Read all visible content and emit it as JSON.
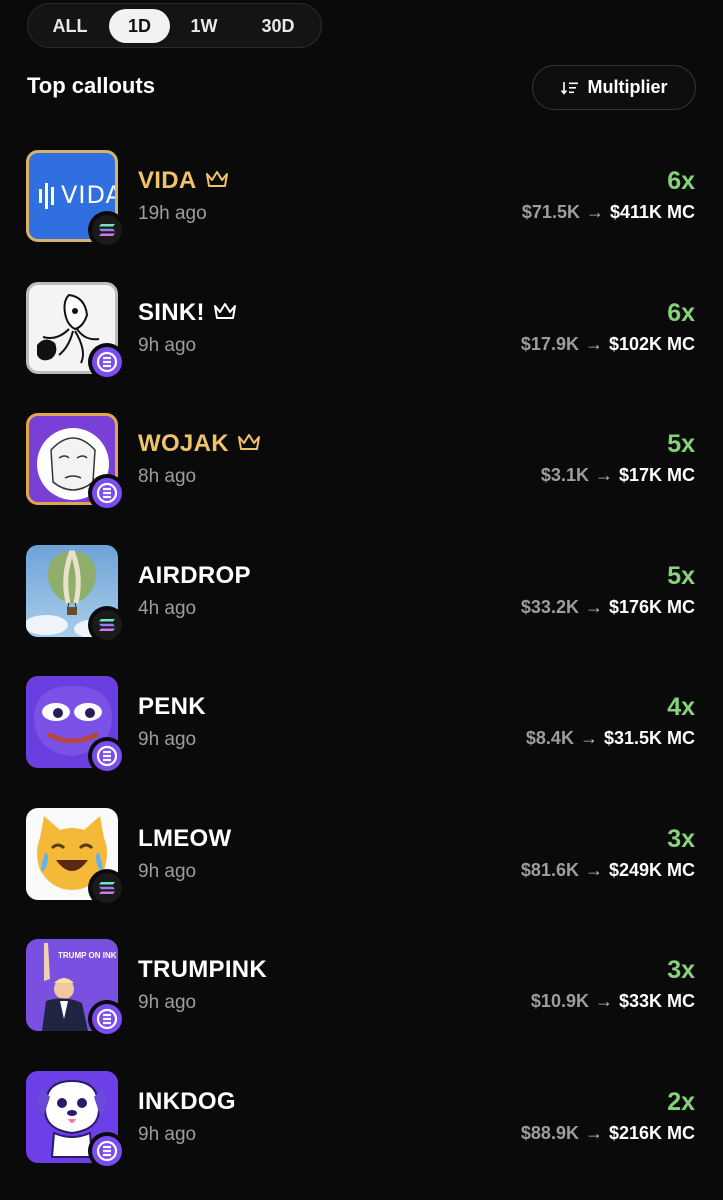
{
  "filters": {
    "tabs": [
      {
        "label": "ALL",
        "active": false
      },
      {
        "label": "1D",
        "active": true
      },
      {
        "label": "1W",
        "active": false
      },
      {
        "label": "30D",
        "active": false
      }
    ]
  },
  "section": {
    "title": "Top callouts",
    "sort_label": "Multiplier"
  },
  "colors": {
    "gain_green": "#86d27a",
    "gold": "#f0c36a",
    "muted": "#9d9d9d"
  },
  "callouts": [
    {
      "name": "VIDA",
      "crown": true,
      "gold": true,
      "ago": "19h ago",
      "multiplier": "6x",
      "from": "$71.5K",
      "to": "$411K MC",
      "chain": "solana",
      "thumb_text": "VIDA"
    },
    {
      "name": "SINK!",
      "crown": true,
      "gold": false,
      "ago": "9h ago",
      "multiplier": "6x",
      "from": "$17.9K",
      "to": "$102K MC",
      "chain": "ink"
    },
    {
      "name": "WOJAK",
      "crown": true,
      "gold": true,
      "ago": "8h ago",
      "multiplier": "5x",
      "from": "$3.1K",
      "to": "$17K MC",
      "chain": "ink"
    },
    {
      "name": "AIRDROP",
      "crown": false,
      "gold": false,
      "ago": "4h ago",
      "multiplier": "5x",
      "from": "$33.2K",
      "to": "$176K MC",
      "chain": "solana"
    },
    {
      "name": "PENK",
      "crown": false,
      "gold": false,
      "ago": "9h ago",
      "multiplier": "4x",
      "from": "$8.4K",
      "to": "$31.5K MC",
      "chain": "ink"
    },
    {
      "name": "LMEOW",
      "crown": false,
      "gold": false,
      "ago": "9h ago",
      "multiplier": "3x",
      "from": "$81.6K",
      "to": "$249K MC",
      "chain": "solana"
    },
    {
      "name": "TRUMPINK",
      "crown": false,
      "gold": false,
      "ago": "9h ago",
      "multiplier": "3x",
      "from": "$10.9K",
      "to": "$33K MC",
      "chain": "ink",
      "thumb_text": "TRUMP ON INK"
    },
    {
      "name": "INKDOG",
      "crown": false,
      "gold": false,
      "ago": "9h ago",
      "multiplier": "2x",
      "from": "$88.9K",
      "to": "$216K MC",
      "chain": "ink"
    }
  ]
}
